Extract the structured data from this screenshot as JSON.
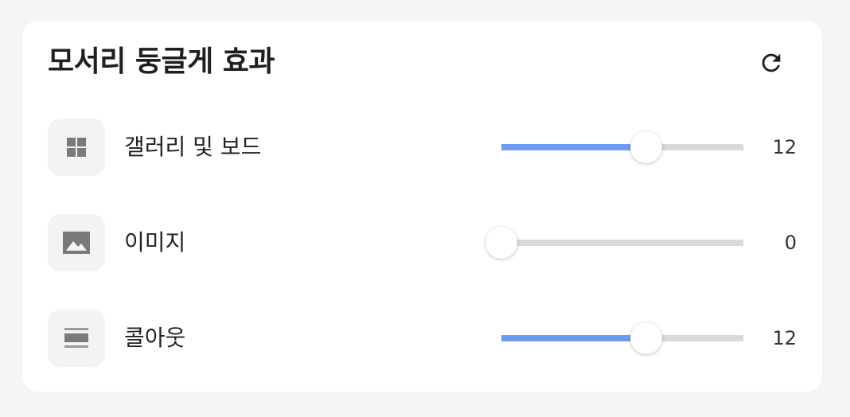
{
  "panel": {
    "title": "모서리 둥글게 효과",
    "reset_icon": "refresh-icon"
  },
  "colors": {
    "accent": "#6b9cf0",
    "track": "#d9d9d9",
    "icon_bg": "#f3f3f3",
    "icon": "#7a7a7a"
  },
  "rows": [
    {
      "icon": "gallery-grid-icon",
      "label": "갤러리 및 보드",
      "value": "12",
      "level": 0.6
    },
    {
      "icon": "image-icon",
      "label": "이미지",
      "value": "0",
      "level": 0.0
    },
    {
      "icon": "layout-collage-icon",
      "label": "콜아웃",
      "value": "12",
      "level": 0.6
    }
  ]
}
